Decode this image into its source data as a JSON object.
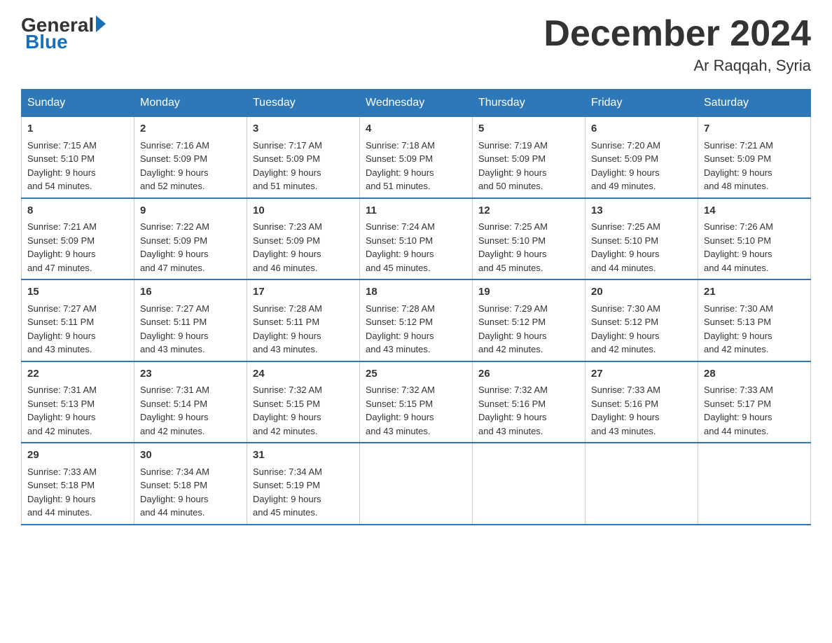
{
  "logo": {
    "general": "General",
    "blue": "Blue"
  },
  "header": {
    "month": "December 2024",
    "location": "Ar Raqqah, Syria"
  },
  "days_of_week": [
    "Sunday",
    "Monday",
    "Tuesday",
    "Wednesday",
    "Thursday",
    "Friday",
    "Saturday"
  ],
  "weeks": [
    [
      {
        "day": "1",
        "sunrise": "7:15 AM",
        "sunset": "5:10 PM",
        "daylight": "9 hours and 54 minutes."
      },
      {
        "day": "2",
        "sunrise": "7:16 AM",
        "sunset": "5:09 PM",
        "daylight": "9 hours and 52 minutes."
      },
      {
        "day": "3",
        "sunrise": "7:17 AM",
        "sunset": "5:09 PM",
        "daylight": "9 hours and 51 minutes."
      },
      {
        "day": "4",
        "sunrise": "7:18 AM",
        "sunset": "5:09 PM",
        "daylight": "9 hours and 51 minutes."
      },
      {
        "day": "5",
        "sunrise": "7:19 AM",
        "sunset": "5:09 PM",
        "daylight": "9 hours and 50 minutes."
      },
      {
        "day": "6",
        "sunrise": "7:20 AM",
        "sunset": "5:09 PM",
        "daylight": "9 hours and 49 minutes."
      },
      {
        "day": "7",
        "sunrise": "7:21 AM",
        "sunset": "5:09 PM",
        "daylight": "9 hours and 48 minutes."
      }
    ],
    [
      {
        "day": "8",
        "sunrise": "7:21 AM",
        "sunset": "5:09 PM",
        "daylight": "9 hours and 47 minutes."
      },
      {
        "day": "9",
        "sunrise": "7:22 AM",
        "sunset": "5:09 PM",
        "daylight": "9 hours and 47 minutes."
      },
      {
        "day": "10",
        "sunrise": "7:23 AM",
        "sunset": "5:09 PM",
        "daylight": "9 hours and 46 minutes."
      },
      {
        "day": "11",
        "sunrise": "7:24 AM",
        "sunset": "5:10 PM",
        "daylight": "9 hours and 45 minutes."
      },
      {
        "day": "12",
        "sunrise": "7:25 AM",
        "sunset": "5:10 PM",
        "daylight": "9 hours and 45 minutes."
      },
      {
        "day": "13",
        "sunrise": "7:25 AM",
        "sunset": "5:10 PM",
        "daylight": "9 hours and 44 minutes."
      },
      {
        "day": "14",
        "sunrise": "7:26 AM",
        "sunset": "5:10 PM",
        "daylight": "9 hours and 44 minutes."
      }
    ],
    [
      {
        "day": "15",
        "sunrise": "7:27 AM",
        "sunset": "5:11 PM",
        "daylight": "9 hours and 43 minutes."
      },
      {
        "day": "16",
        "sunrise": "7:27 AM",
        "sunset": "5:11 PM",
        "daylight": "9 hours and 43 minutes."
      },
      {
        "day": "17",
        "sunrise": "7:28 AM",
        "sunset": "5:11 PM",
        "daylight": "9 hours and 43 minutes."
      },
      {
        "day": "18",
        "sunrise": "7:28 AM",
        "sunset": "5:12 PM",
        "daylight": "9 hours and 43 minutes."
      },
      {
        "day": "19",
        "sunrise": "7:29 AM",
        "sunset": "5:12 PM",
        "daylight": "9 hours and 42 minutes."
      },
      {
        "day": "20",
        "sunrise": "7:30 AM",
        "sunset": "5:12 PM",
        "daylight": "9 hours and 42 minutes."
      },
      {
        "day": "21",
        "sunrise": "7:30 AM",
        "sunset": "5:13 PM",
        "daylight": "9 hours and 42 minutes."
      }
    ],
    [
      {
        "day": "22",
        "sunrise": "7:31 AM",
        "sunset": "5:13 PM",
        "daylight": "9 hours and 42 minutes."
      },
      {
        "day": "23",
        "sunrise": "7:31 AM",
        "sunset": "5:14 PM",
        "daylight": "9 hours and 42 minutes."
      },
      {
        "day": "24",
        "sunrise": "7:32 AM",
        "sunset": "5:15 PM",
        "daylight": "9 hours and 42 minutes."
      },
      {
        "day": "25",
        "sunrise": "7:32 AM",
        "sunset": "5:15 PM",
        "daylight": "9 hours and 43 minutes."
      },
      {
        "day": "26",
        "sunrise": "7:32 AM",
        "sunset": "5:16 PM",
        "daylight": "9 hours and 43 minutes."
      },
      {
        "day": "27",
        "sunrise": "7:33 AM",
        "sunset": "5:16 PM",
        "daylight": "9 hours and 43 minutes."
      },
      {
        "day": "28",
        "sunrise": "7:33 AM",
        "sunset": "5:17 PM",
        "daylight": "9 hours and 44 minutes."
      }
    ],
    [
      {
        "day": "29",
        "sunrise": "7:33 AM",
        "sunset": "5:18 PM",
        "daylight": "9 hours and 44 minutes."
      },
      {
        "day": "30",
        "sunrise": "7:34 AM",
        "sunset": "5:18 PM",
        "daylight": "9 hours and 44 minutes."
      },
      {
        "day": "31",
        "sunrise": "7:34 AM",
        "sunset": "5:19 PM",
        "daylight": "9 hours and 45 minutes."
      },
      null,
      null,
      null,
      null
    ]
  ],
  "labels": {
    "sunrise": "Sunrise:",
    "sunset": "Sunset:",
    "daylight": "Daylight:"
  }
}
